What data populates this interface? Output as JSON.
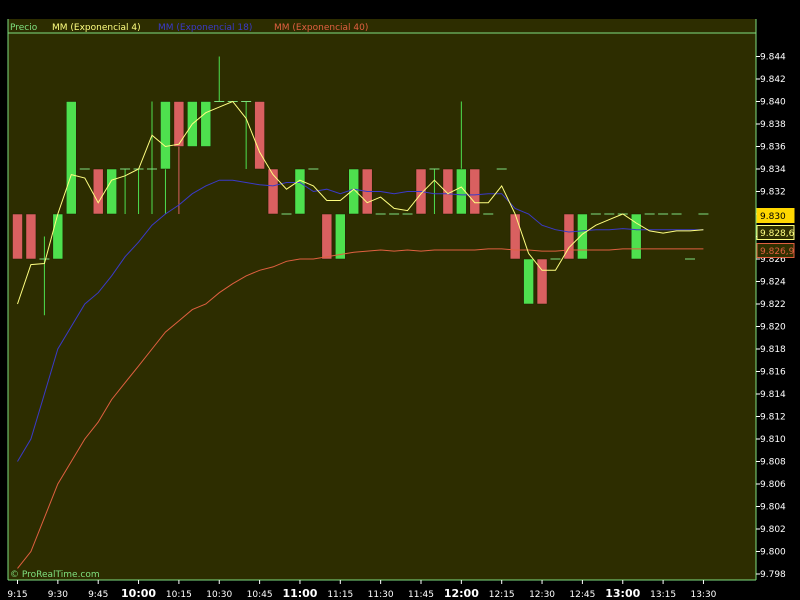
{
  "chart_data": {
    "type": "candlestick",
    "title": "",
    "legend": [
      {
        "name": "Precio",
        "color": "#7fe07f"
      },
      {
        "name": "MM (Exponencial 4)",
        "color": "#ffff80"
      },
      {
        "name": "MM (Exponencial 18)",
        "color": "#3a3ac8"
      },
      {
        "name": "MM (Exponencial 40)",
        "color": "#e06040"
      }
    ],
    "ylim": [
      9.7975,
      9.8475
    ],
    "yticks": [
      "9.798",
      "9.800",
      "9.802",
      "9.804",
      "9.806",
      "9.808",
      "9.810",
      "9.812",
      "9.814",
      "9.816",
      "9.818",
      "9.820",
      "9.822",
      "9.824",
      "9.826",
      "9.828",
      "9.830",
      "9.832",
      "9.834",
      "9.836",
      "9.838",
      "9.840",
      "9.842",
      "9.844"
    ],
    "xticks": [
      {
        "label": "9:15",
        "bar": 0,
        "bold": false
      },
      {
        "label": "9:30",
        "bar": 3,
        "bold": false
      },
      {
        "label": "9:45",
        "bar": 6,
        "bold": false
      },
      {
        "label": "10:00",
        "bar": 9,
        "bold": true
      },
      {
        "label": "10:15",
        "bar": 12,
        "bold": false
      },
      {
        "label": "10:30",
        "bar": 15,
        "bold": false
      },
      {
        "label": "10:45",
        "bar": 18,
        "bold": false
      },
      {
        "label": "11:00",
        "bar": 21,
        "bold": true
      },
      {
        "label": "11:15",
        "bar": 24,
        "bold": false
      },
      {
        "label": "11:30",
        "bar": 27,
        "bold": false
      },
      {
        "label": "11:45",
        "bar": 30,
        "bold": false
      },
      {
        "label": "12:00",
        "bar": 33,
        "bold": true
      },
      {
        "label": "12:15",
        "bar": 36,
        "bold": false
      },
      {
        "label": "12:30",
        "bar": 39,
        "bold": false
      },
      {
        "label": "12:45",
        "bar": 42,
        "bold": false
      },
      {
        "label": "13:00",
        "bar": 45,
        "bold": true
      },
      {
        "label": "13:15",
        "bar": 48,
        "bold": false
      },
      {
        "label": "13:30",
        "bar": 51,
        "bold": false
      }
    ],
    "candles": [
      [
        9.83,
        9.83,
        9.826,
        9.826
      ],
      [
        9.83,
        9.83,
        9.826,
        9.826
      ],
      [
        9.826,
        9.828,
        9.821,
        9.826
      ],
      [
        9.826,
        9.83,
        9.826,
        9.83
      ],
      [
        9.83,
        9.84,
        9.83,
        9.84
      ],
      [
        9.834,
        9.834,
        9.834,
        9.834
      ],
      [
        9.834,
        9.834,
        9.83,
        9.83
      ],
      [
        9.83,
        9.834,
        9.83,
        9.834
      ],
      [
        9.834,
        9.834,
        9.83,
        9.834
      ],
      [
        9.834,
        9.834,
        9.83,
        9.834
      ],
      [
        9.834,
        9.84,
        9.83,
        9.834
      ],
      [
        9.834,
        9.84,
        9.83,
        9.84
      ],
      [
        9.84,
        9.84,
        9.83,
        9.836
      ],
      [
        9.836,
        9.84,
        9.836,
        9.84
      ],
      [
        9.836,
        9.84,
        9.836,
        9.84
      ],
      [
        9.84,
        9.844,
        9.84,
        9.84
      ],
      [
        9.84,
        9.84,
        9.84,
        9.84
      ],
      [
        9.84,
        9.84,
        9.834,
        9.84
      ],
      [
        9.84,
        9.84,
        9.834,
        9.834
      ],
      [
        9.834,
        9.834,
        9.83,
        9.83
      ],
      [
        9.83,
        9.83,
        9.83,
        9.83
      ],
      [
        9.83,
        9.834,
        9.83,
        9.834
      ],
      [
        9.834,
        9.834,
        9.834,
        9.834
      ],
      [
        9.83,
        9.83,
        9.826,
        9.826
      ],
      [
        9.826,
        9.83,
        9.826,
        9.83
      ],
      [
        9.83,
        9.834,
        9.83,
        9.834
      ],
      [
        9.834,
        9.834,
        9.83,
        9.83
      ],
      [
        9.83,
        9.83,
        9.83,
        9.83
      ],
      [
        9.83,
        9.83,
        9.83,
        9.83
      ],
      [
        9.83,
        9.83,
        9.83,
        9.83
      ],
      [
        9.834,
        9.834,
        9.83,
        9.83
      ],
      [
        9.834,
        9.834,
        9.83,
        9.834
      ],
      [
        9.834,
        9.834,
        9.83,
        9.83
      ],
      [
        9.83,
        9.84,
        9.83,
        9.834
      ],
      [
        9.834,
        9.834,
        9.83,
        9.83
      ],
      [
        9.83,
        9.83,
        9.83,
        9.83
      ],
      [
        9.834,
        9.834,
        9.834,
        9.834
      ],
      [
        9.83,
        9.83,
        9.826,
        9.826
      ],
      [
        9.822,
        9.826,
        9.822,
        9.826
      ],
      [
        9.826,
        9.826,
        9.822,
        9.822
      ],
      [
        9.826,
        9.826,
        9.826,
        9.826
      ],
      [
        9.83,
        9.83,
        9.826,
        9.826
      ],
      [
        9.826,
        9.83,
        9.826,
        9.83
      ],
      [
        9.83,
        9.83,
        9.83,
        9.83
      ],
      [
        9.83,
        9.83,
        9.83,
        9.83
      ],
      [
        9.83,
        9.83,
        9.83,
        9.83
      ],
      [
        9.826,
        9.83,
        9.826,
        9.83
      ],
      [
        9.83,
        9.83,
        9.83,
        9.83
      ],
      [
        9.83,
        9.83,
        9.83,
        9.83
      ],
      [
        9.83,
        9.83,
        9.83,
        9.83
      ],
      [
        9.826,
        9.826,
        9.826,
        9.826
      ],
      [
        9.83,
        9.83,
        9.83,
        9.83
      ]
    ],
    "ema4": [
      9.822,
      9.8255,
      9.8256,
      9.83,
      9.8335,
      9.8332,
      9.831,
      9.833,
      9.8334,
      9.834,
      9.837,
      9.836,
      9.8362,
      9.838,
      9.839,
      9.8395,
      9.84,
      9.8385,
      9.8355,
      9.8335,
      9.8322,
      9.833,
      9.8325,
      9.8312,
      9.8312,
      9.8322,
      9.831,
      9.8315,
      9.8305,
      9.8303,
      9.8318,
      9.833,
      9.8318,
      9.8324,
      9.831,
      9.831,
      9.8325,
      9.83,
      9.8265,
      9.825,
      9.825,
      9.827,
      9.8282,
      9.829,
      9.8295,
      9.83,
      9.8292,
      9.8285,
      9.8283,
      9.8285,
      9.8285,
      9.8286
    ],
    "ema18": [
      9.808,
      9.81,
      9.814,
      9.818,
      9.82,
      9.822,
      9.823,
      9.8245,
      9.8262,
      9.8275,
      9.829,
      9.83,
      9.8308,
      9.8318,
      9.8325,
      9.833,
      9.833,
      9.8328,
      9.8326,
      9.8325,
      9.8328,
      9.8328,
      9.832,
      9.8322,
      9.8318,
      9.8322,
      9.832,
      9.832,
      9.8318,
      9.832,
      9.832,
      9.8318,
      9.8318,
      9.8317,
      9.8317,
      9.8318,
      9.8318,
      9.8305,
      9.83,
      9.829,
      9.8286,
      9.8284,
      9.8285,
      9.8286,
      9.8286,
      9.8287,
      9.8286,
      9.8286,
      9.8286,
      9.8286,
      9.8286,
      9.8286
    ],
    "ema40": [
      9.7985,
      9.8,
      9.803,
      9.806,
      9.808,
      9.81,
      9.8115,
      9.8135,
      9.815,
      9.8165,
      9.818,
      9.8195,
      9.8205,
      9.8215,
      9.822,
      9.823,
      9.8238,
      9.8245,
      9.825,
      9.8253,
      9.8258,
      9.826,
      9.826,
      9.8262,
      9.8264,
      9.8266,
      9.8267,
      9.8268,
      9.8267,
      9.8268,
      9.8267,
      9.8268,
      9.8268,
      9.8268,
      9.8268,
      9.8269,
      9.8269,
      9.8268,
      9.8268,
      9.8267,
      9.8267,
      9.8268,
      9.8268,
      9.8268,
      9.8268,
      9.8269,
      9.8269,
      9.8269,
      9.8269,
      9.8269,
      9.8269,
      9.8269
    ],
    "price_tags": [
      {
        "value": "9.830",
        "y": 9.83,
        "bg": "#ffd700",
        "fg": "#000000"
      },
      {
        "value": "9.828,6",
        "y": 9.8286,
        "bg": "#303000",
        "fg": "#ffff80",
        "border": "#ffff80"
      },
      {
        "value": "9.826,9",
        "y": 9.8269,
        "bg": "#303000",
        "fg": "#e06040",
        "border": "#e06040"
      }
    ],
    "grid": false,
    "colors": {
      "background": "#2d2d00",
      "bull": "#4ee04e",
      "bear": "#d96060",
      "axis": "#ffffff",
      "frame": "#7fe07f"
    },
    "watermark": "© ProRealTime.com"
  }
}
